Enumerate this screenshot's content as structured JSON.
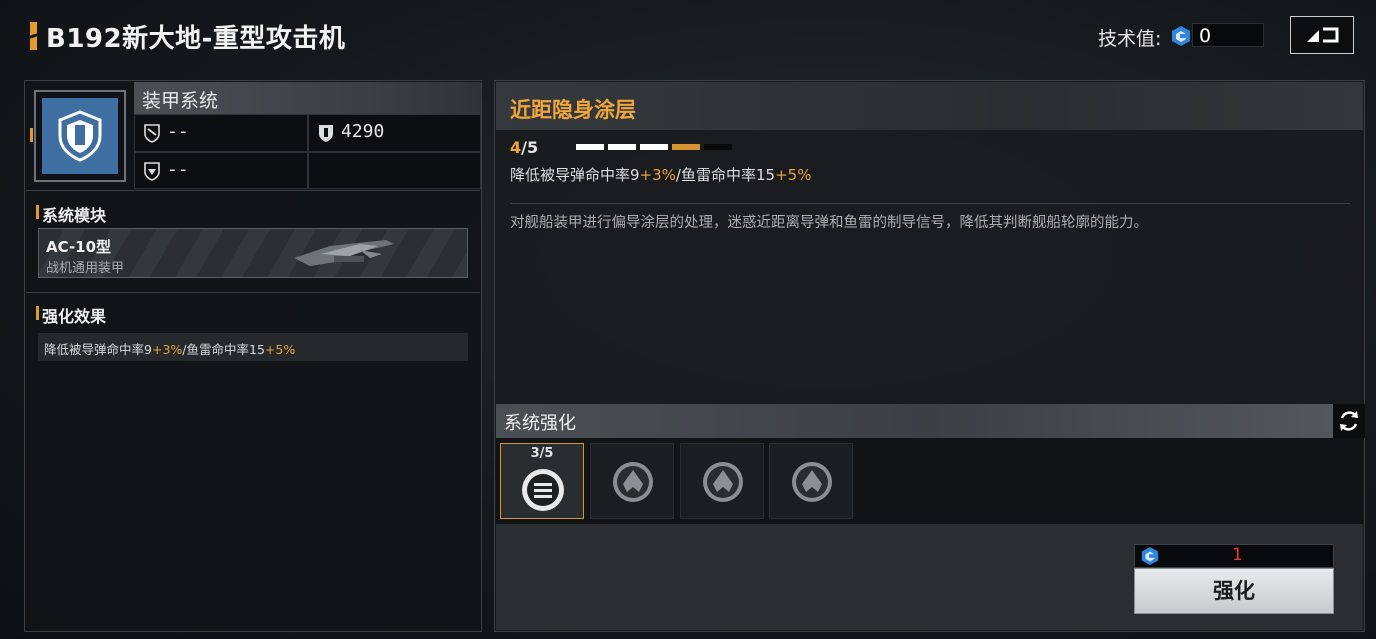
{
  "header": {
    "title": "B192新大地-重型攻击机",
    "tech_label": "技术值:",
    "tech_value": "0"
  },
  "armor": {
    "name": "装甲系统",
    "stats": [
      {
        "icon": "missile-armor-icon",
        "value": "--"
      },
      {
        "icon": "shield-icon",
        "value": "4290"
      },
      {
        "icon": "torpedo-armor-icon",
        "value": "--"
      },
      {
        "icon": "",
        "value": ""
      }
    ]
  },
  "module": {
    "section_title": "系统模块",
    "name": "AC-10型",
    "subtitle": "战机通用装甲"
  },
  "effect": {
    "section_title": "强化效果",
    "text_a": "降低被导弹命中率9",
    "bonus_a": "+3%",
    "text_b": "/鱼雷命中率15",
    "bonus_b": "+5%"
  },
  "skill": {
    "title": "近距隐身涂层",
    "level_current": "4",
    "level_total": "/5",
    "level_value": 4,
    "level_max": 5,
    "desc_a": "降低被导弹命中率9",
    "bonus_a": "+3%",
    "desc_b": "/鱼雷命中率15",
    "bonus_b": "+5%",
    "description": "对舰船装甲进行偏导涂层的处理，迷惑近距离导弹和鱼雷的制导信号，降低其判断舰船轮廓的能力。"
  },
  "enhance": {
    "section_title": "系统强化",
    "slots": [
      {
        "count": "3/5",
        "icon": "menu-lines-icon",
        "active": true
      },
      {
        "count": "",
        "icon": "ship-emblem-icon",
        "active": false
      },
      {
        "count": "",
        "icon": "ship-emblem-icon",
        "active": false
      },
      {
        "count": "",
        "icon": "ship-emblem-icon",
        "active": false
      }
    ],
    "cost": "1",
    "button_label": "强化"
  },
  "colors": {
    "accent": "#e39a2a",
    "cost_red": "#e33a33",
    "level_filled": "#ffffff",
    "level_current": "#d59531",
    "level_empty": "#0a0a0a"
  }
}
